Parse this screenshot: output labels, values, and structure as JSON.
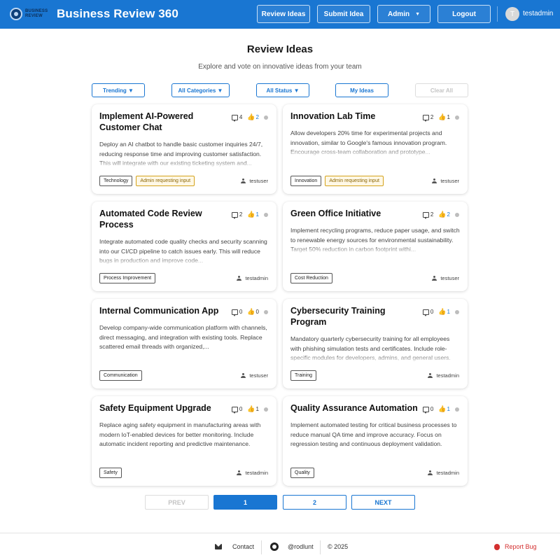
{
  "header": {
    "logo_text_line1": "BUSINESS",
    "logo_text_line2": "REVIEW",
    "title": "Business Review 360",
    "nav": {
      "review_ideas": "Review Ideas",
      "submit_idea": "Submit Idea",
      "admin": "Admin",
      "logout": "Logout"
    },
    "avatar_initial": "T",
    "username": "testadmin",
    "colors": {
      "bar": "#1976d2"
    }
  },
  "page": {
    "title": "Review Ideas",
    "subtitle": "Explore and vote on innovative ideas from your team"
  },
  "filters": {
    "sort": "Trending ▼",
    "category": "All Categories ▼",
    "status": "All Status ▼",
    "my_ideas": "My Ideas",
    "clear_all": "Clear All"
  },
  "ideas": [
    {
      "title": "Implement AI-Powered Customer Chat",
      "comments": "4",
      "likes": "2",
      "description": "Deploy an AI chatbot to handle basic customer inquiries 24/7, reducing response time and improving customer satisfaction. This will integrate with our existing ticketing system and...",
      "tags": [
        "Technology",
        "Admin requesting input"
      ],
      "author": "testuser"
    },
    {
      "title": "Innovation Lab Time",
      "comments": "2",
      "likes": "1",
      "description": "Allow developers 20% time for experimental projects and innovation, similar to Google's famous innovation program. Encourage cross-team collaboration and prototype...",
      "tags": [
        "Innovation",
        "Admin requesting input"
      ],
      "author": "testuser"
    },
    {
      "title": "Automated Code Review Process",
      "comments": "2",
      "likes": "1",
      "description": "Integrate automated code quality checks and security scanning into our CI/CD pipeline to catch issues early. This will reduce bugs in production and improve code...",
      "tags": [
        "Process Improvement"
      ],
      "author": "testadmin"
    },
    {
      "title": "Green Office Initiative",
      "comments": "2",
      "likes": "2",
      "description": "Implement recycling programs, reduce paper usage, and switch to renewable energy sources for environmental sustainability. Target 50% reduction in carbon footprint withi...",
      "tags": [
        "Cost Reduction"
      ],
      "author": "testuser"
    },
    {
      "title": "Internal Communication App",
      "comments": "0",
      "likes": "0",
      "description": "Develop company-wide communication platform with channels, direct messaging, and integration with existing tools. Replace scattered email threads with organized,...",
      "tags": [
        "Communication"
      ],
      "author": "testuser"
    },
    {
      "title": "Cybersecurity Training Program",
      "comments": "0",
      "likes": "1",
      "description": "Mandatory quarterly cybersecurity training for all employees with phishing simulation tests and certificates. Include role-specific modules for developers, admins, and general users.",
      "tags": [
        "Training"
      ],
      "author": "testadmin"
    },
    {
      "title": "Safety Equipment Upgrade",
      "comments": "0",
      "likes": "1",
      "description": "Replace aging safety equipment in manufacturing areas with modern IoT-enabled devices for better monitoring. Include automatic incident reporting and predictive maintenance.",
      "tags": [
        "Safety"
      ],
      "author": "testadmin"
    },
    {
      "title": "Quality Assurance Automation",
      "comments": "0",
      "likes": "1",
      "description": "Implement automated testing for critical business processes to reduce manual QA time and improve accuracy. Focus on regression testing and continuous deployment validation.",
      "tags": [
        "Quality"
      ],
      "author": "testadmin"
    }
  ],
  "pagination": {
    "prev": "PREV",
    "page1": "1",
    "page2": "2",
    "next": "NEXT"
  },
  "footer": {
    "contact": "Contact",
    "github": "@rodlunt",
    "copyright": "© 2025",
    "report_bug": "Report Bug"
  }
}
